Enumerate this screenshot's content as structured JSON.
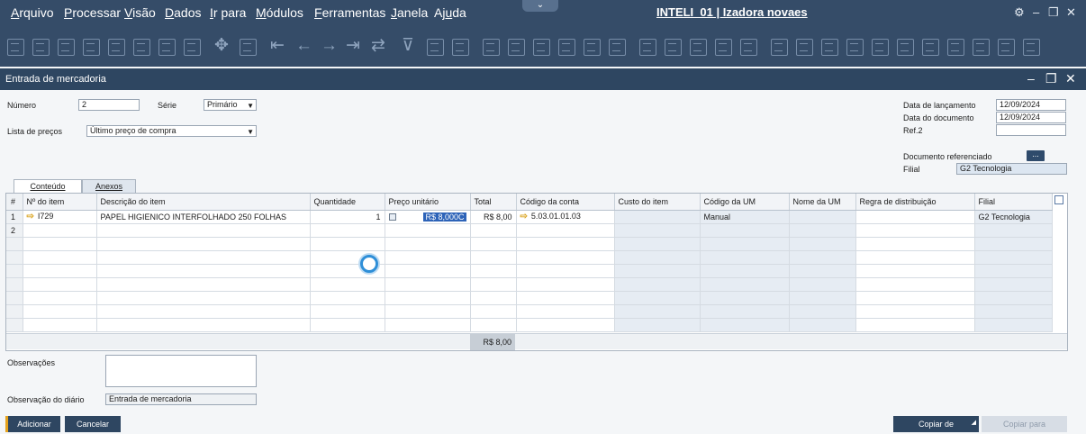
{
  "menu": {
    "items": [
      {
        "pre": "",
        "u": "A",
        "post": "rquivo"
      },
      {
        "pre": "",
        "u": "P",
        "post": "rocessar"
      },
      {
        "pre": "",
        "u": "V",
        "post": "isão"
      },
      {
        "pre": "",
        "u": "D",
        "post": "ados"
      },
      {
        "pre": "",
        "u": "I",
        "post": "r para"
      },
      {
        "pre": "",
        "u": "M",
        "post": "ódulos"
      },
      {
        "pre": "",
        "u": "F",
        "post": "erramentas"
      },
      {
        "pre": "",
        "u": "J",
        "post": "anela"
      },
      {
        "pre": "Aj",
        "u": "u",
        "post": "da"
      }
    ],
    "title": "INTELI_01 | Izadora novaes",
    "icons": [
      "collapse-chevron-icon",
      "settings-icon",
      "minimize-icon",
      "restore-icon",
      "close-icon"
    ]
  },
  "toolbar": {
    "icons": [
      "print-icon",
      "print-preview-icon",
      "document-icon",
      "export-icon",
      "email-icon",
      "excel-icon",
      "word-icon",
      "pdf-icon",
      "move-icon",
      "find-icon",
      "first-record-icon",
      "previous-record-icon",
      "next-record-icon",
      "last-record-icon",
      "refresh-icon",
      "filter-icon",
      "sort-icon",
      "base-document-icon",
      "target-document-icon",
      "gross-profit-icon",
      "currency-icon",
      "journal-icon",
      "payment-icon",
      "drill-down-icon",
      "edit-icon",
      "settings-icon",
      "form-settings-icon",
      "messages-icon",
      "alerts-icon",
      "calendar-icon",
      "alarm-icon",
      "calculator-icon",
      "users-icon",
      "user-icon",
      "layout-icon",
      "grid-icon",
      "transaction-icon",
      "approval-icon",
      "web-icon",
      "help-icon"
    ]
  },
  "window": {
    "title": "Entrada de mercadoria",
    "controls": [
      "minimize-icon",
      "restore-icon",
      "close-icon"
    ]
  },
  "header": {
    "numero_label": "Número",
    "numero_value": "2",
    "serie_label": "Série",
    "serie_value": "Primário",
    "lista_precos_label": "Lista de preços",
    "lista_precos_value": "Último preço de compra",
    "data_lancamento_label": "Data de lançamento",
    "data_lancamento_value": "12/09/2024",
    "data_documento_label": "Data do documento",
    "data_documento_value": "12/09/2024",
    "ref2_label": "Ref.2",
    "ref2_value": "",
    "doc_ref_label": "Documento referenciado",
    "doc_ref_button": "...",
    "filial_label": "Filial",
    "filial_value": "G2 Tecnologia"
  },
  "tabs": [
    {
      "label": "Conteúdo",
      "active": true
    },
    {
      "label": "Anexos",
      "active": false
    }
  ],
  "grid": {
    "columns": [
      "#",
      "Nº do item",
      "Descrição do item",
      "Quantidade",
      "Preço unitário",
      "Total",
      "Código da conta",
      "Custo do item",
      "Código da UM",
      "Nome da UM",
      "Regra de distribuição",
      "Filial"
    ],
    "rows": [
      {
        "n": "1",
        "item": "I729",
        "descricao": "PAPEL HIGIENICO INTERFOLHADO 250 FOLHAS",
        "quantidade": "1",
        "preco": "R$ 8,000C",
        "total": "R$ 8,00",
        "conta": "5.03.01.01.03",
        "custo": "",
        "cod_um": "Manual",
        "nome_um": "",
        "regra": "",
        "filial": "G2 Tecnologia"
      },
      {
        "n": "2",
        "item": "",
        "descricao": "",
        "quantidade": "",
        "preco": "",
        "total": "",
        "conta": "",
        "custo": "",
        "cod_um": "",
        "nome_um": "",
        "regra": "",
        "filial": ""
      }
    ],
    "empty_rows": 7,
    "footer_total": "R$ 8,00"
  },
  "footer": {
    "observacoes_label": "Observações",
    "observacoes_value": "",
    "obs_diario_label": "Observação do diário",
    "obs_diario_value": "Entrada de mercadoria"
  },
  "buttons": {
    "adicionar": "Adicionar",
    "cancelar": "Cancelar",
    "copiar_de": "Copiar de",
    "copiar_para": "Copiar para"
  },
  "colors": {
    "topbar": "#354c68",
    "window_header": "#2e4661",
    "button": "#2e4661",
    "accent_orange": "#e5a21c",
    "selection_blue": "#2d63b8"
  }
}
